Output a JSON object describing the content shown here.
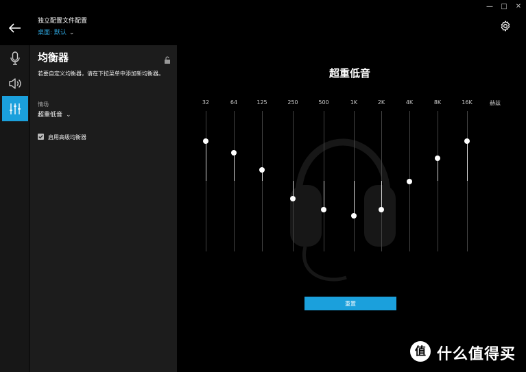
{
  "header": {
    "profile_title": "独立配置文件配置",
    "profile_subtitle": "桌面: 默认",
    "back_icon": "arrow-left-icon",
    "settings_icon": "gear-icon"
  },
  "window_controls": {
    "minimize": "—",
    "maximize": "□",
    "close": "✕"
  },
  "rail": {
    "items": [
      {
        "icon": "microphone-icon",
        "active": false
      },
      {
        "icon": "speaker-icon",
        "active": false
      },
      {
        "icon": "equalizer-icon",
        "active": true
      }
    ]
  },
  "panel": {
    "title": "均衡器",
    "description": "若要自定义均衡器，请在下拉菜单中添加新均衡器。",
    "preset_label": "情场",
    "preset_value": "超重低音",
    "advanced_eq_label": "启用高级均衡器",
    "advanced_eq_checked": true
  },
  "eq": {
    "title": "超重低音",
    "unit_label": "赫兹",
    "bands": [
      {
        "freq": "32",
        "gain": 0.58
      },
      {
        "freq": "64",
        "gain": 0.41
      },
      {
        "freq": "125",
        "gain": 0.16
      },
      {
        "freq": "250",
        "gain": -0.26
      },
      {
        "freq": "500",
        "gain": -0.42
      },
      {
        "freq": "1K",
        "gain": -0.51
      },
      {
        "freq": "2K",
        "gain": -0.42
      },
      {
        "freq": "4K",
        "gain": -0.01
      },
      {
        "freq": "8K",
        "gain": 0.33
      },
      {
        "freq": "16K",
        "gain": 0.58
      }
    ],
    "reset_label": "重置"
  },
  "watermark": {
    "logo": "值",
    "text": "什么值得买"
  },
  "colors": {
    "accent": "#1ba0dc",
    "background": "#000000",
    "panel": "#1c1c1c"
  }
}
